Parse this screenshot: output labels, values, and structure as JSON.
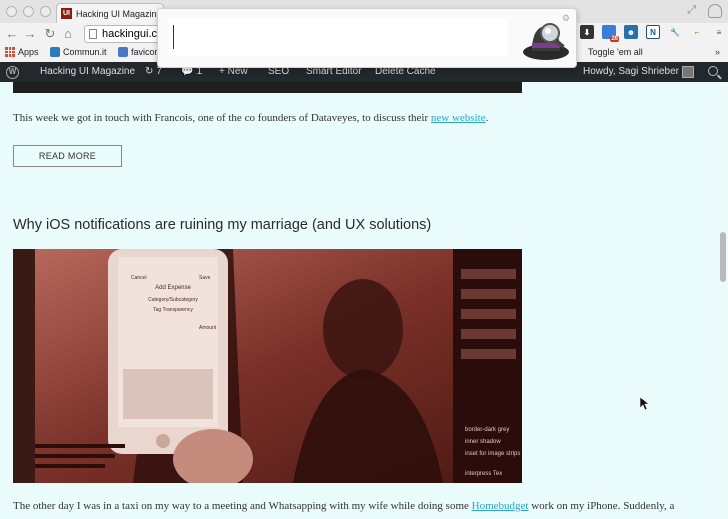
{
  "browser": {
    "tab_title": "Hacking UI Magazine | ...",
    "tab_favicon_text": "UI",
    "url": "hackingui.com",
    "bookmarks": [
      {
        "label": "Apps"
      },
      {
        "label": "Commun.it"
      },
      {
        "label": "favicon"
      }
    ],
    "toggle_label": "Toggle 'em all",
    "overflow_label": "»",
    "extension_badge": "26",
    "extension_n_label": "N"
  },
  "launcher": {
    "query": ""
  },
  "admin_bar": {
    "site_name": "Hacking UI Magazine",
    "updates_count": "7",
    "comments_count": "1",
    "new_label": "+ New",
    "seo_label": "SEO",
    "smart_editor_label": "Smart Editor",
    "delete_cache_label": "Delete Cache",
    "greeting": "Howdy, Sagi Shrieber"
  },
  "post_prev": {
    "excerpt_before": "This week we got in touch with Francois, one of the co founders of Dataveyes, to discuss their ",
    "excerpt_link": "new website",
    "excerpt_after": ".",
    "read_more_label": "READ MORE"
  },
  "post": {
    "title": "Why iOS notifications are ruining my marriage (and UX solutions)",
    "image_labels": [
      "Add Expense",
      "Category/Subcategory",
      "Tag Transparency",
      "Cancel",
      "Save",
      "Amount",
      "border-dark grey",
      "inset for image strips",
      "interpress Tex",
      "inner shadow"
    ],
    "excerpt_before": "The other day I was in a taxi on my way to a meeting and Whatsapping with my wife while doing some ",
    "excerpt_link": "Homebudget",
    "excerpt_after": " work on my iPhone. Suddenly, a"
  },
  "colors": {
    "page_bg": "#e9fbfb",
    "link": "#2aa7c5",
    "admin_bar": "#23282d"
  }
}
